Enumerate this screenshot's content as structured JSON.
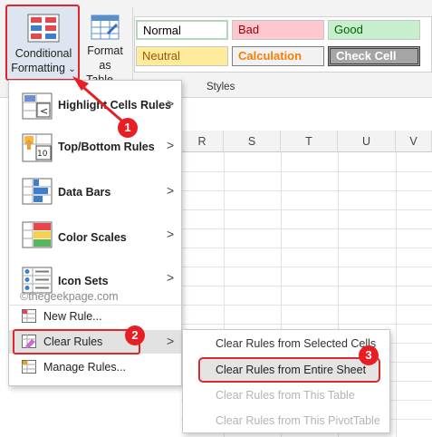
{
  "ribbon": {
    "conditional_formatting": {
      "line1": "Conditional",
      "line2": "Formatting",
      "caret": "⌄"
    },
    "format_as_table": {
      "line1": "Format as",
      "line2": "Table",
      "caret": "⌄"
    },
    "styles_group_label": "Styles",
    "cell_styles": [
      {
        "label": "Normal",
        "bg": "#ffffff",
        "color": "#000000"
      },
      {
        "label": "Bad",
        "bg": "#ffc7ce",
        "color": "#9c0006"
      },
      {
        "label": "Good",
        "bg": "#c6efce",
        "color": "#006100"
      },
      {
        "label": "Neutral",
        "bg": "#ffeb9c",
        "color": "#9c5700"
      },
      {
        "label": "Calculation",
        "bg": "#f2f2f2",
        "color": "#fa7d00"
      },
      {
        "label": "Check Cell",
        "bg": "#a5a5a5",
        "color": "#ffffff"
      }
    ]
  },
  "columns": [
    "R",
    "S",
    "T",
    "U",
    "V"
  ],
  "menu": {
    "items": [
      {
        "label": "Highlight Cells Rules",
        "icon": "highlight-cells-rules-icon",
        "has_submenu": true
      },
      {
        "label": "Top/Bottom Rules",
        "icon": "top-bottom-rules-icon",
        "has_submenu": true
      },
      {
        "label": "Data Bars",
        "icon": "data-bars-icon",
        "has_submenu": true
      },
      {
        "label": "Color Scales",
        "icon": "color-scales-icon",
        "has_submenu": true
      },
      {
        "label": "Icon Sets",
        "icon": "icon-sets-icon",
        "has_submenu": true
      }
    ],
    "new_rule": "New Rule...",
    "clear_rules": "Clear Rules",
    "manage_rules": "Manage Rules...",
    "chevron": ">"
  },
  "submenu": {
    "items": [
      {
        "label": "Clear Rules from Selected Cells",
        "enabled": true
      },
      {
        "label": "Clear Rules from Entire Sheet",
        "enabled": true
      },
      {
        "label": "Clear Rules from This Table",
        "enabled": false
      },
      {
        "label": "Clear Rules from This PivotTable",
        "enabled": false
      }
    ]
  },
  "annotations": {
    "badge1": "1",
    "badge2": "2",
    "badge3": "3",
    "color": "#e81e25"
  },
  "watermark": "©thegeekpage.com"
}
